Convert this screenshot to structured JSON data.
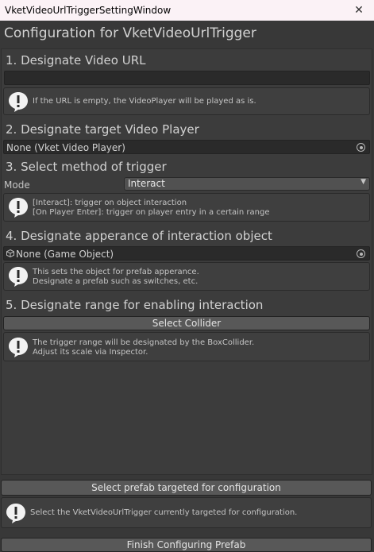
{
  "window": {
    "title": "VketVideoUrlTriggerSettingWindow",
    "close_glyph": "✕"
  },
  "main_title": "Configuration for VketVideoUrlTrigger",
  "section1": {
    "heading": "1. Designate Video URL",
    "url_value": "",
    "help": "If the URL is empty, the VideoPlayer will be played as is."
  },
  "section2": {
    "heading": "2. Designate target Video Player",
    "field_value": "None (Vket Video Player)"
  },
  "section3": {
    "heading": "3. Select method of trigger",
    "mode_label": "Mode",
    "mode_value": "Interact",
    "help_line1": "[Interact]: trigger on object interaction",
    "help_line2": "[On Player Enter]: trigger on player entry in a certain range"
  },
  "section4": {
    "heading": "4. Designate apperance of interaction object",
    "field_value": "None (Game Object)",
    "help_line1": "This sets the object for prefab apperance.",
    "help_line2": "Designate a prefab such as switches, etc."
  },
  "section5": {
    "heading": "5. Designate range for enabling interaction",
    "button": "Select Collider",
    "help_line1": "The trigger range will be designated by the BoxCollider.",
    "help_line2": "Adjust its scale via Inspector."
  },
  "footer": {
    "select_prefab_button": "Select prefab targeted for configuration",
    "help": "Select the VketVideoUrlTrigger currently targeted for configuration.",
    "finish_button": "Finish Configuring Prefab"
  },
  "icons": {
    "help": "speech-bubble-exclamation-icon",
    "picker": "object-picker-icon",
    "dropdown": "triangle-down-icon",
    "gameobject": "cube-icon"
  }
}
